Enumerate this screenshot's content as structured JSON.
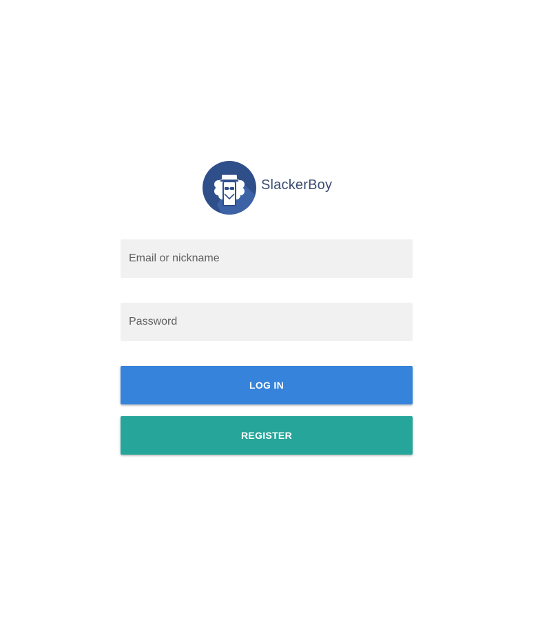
{
  "brand": {
    "name": "SlackerBoy",
    "logo_icon": "slacker-boy-logo-icon"
  },
  "form": {
    "email_placeholder": "Email or nickname",
    "password_placeholder": "Password",
    "login_label": "LOG IN",
    "register_label": "REGISTER"
  },
  "colors": {
    "background": "#ffffff",
    "field_background": "#f1f1f1",
    "login_button": "#3683dc",
    "register_button": "#26a69a",
    "logo_circle": "#2f4f8a",
    "logo_text": "#3a4c72"
  }
}
